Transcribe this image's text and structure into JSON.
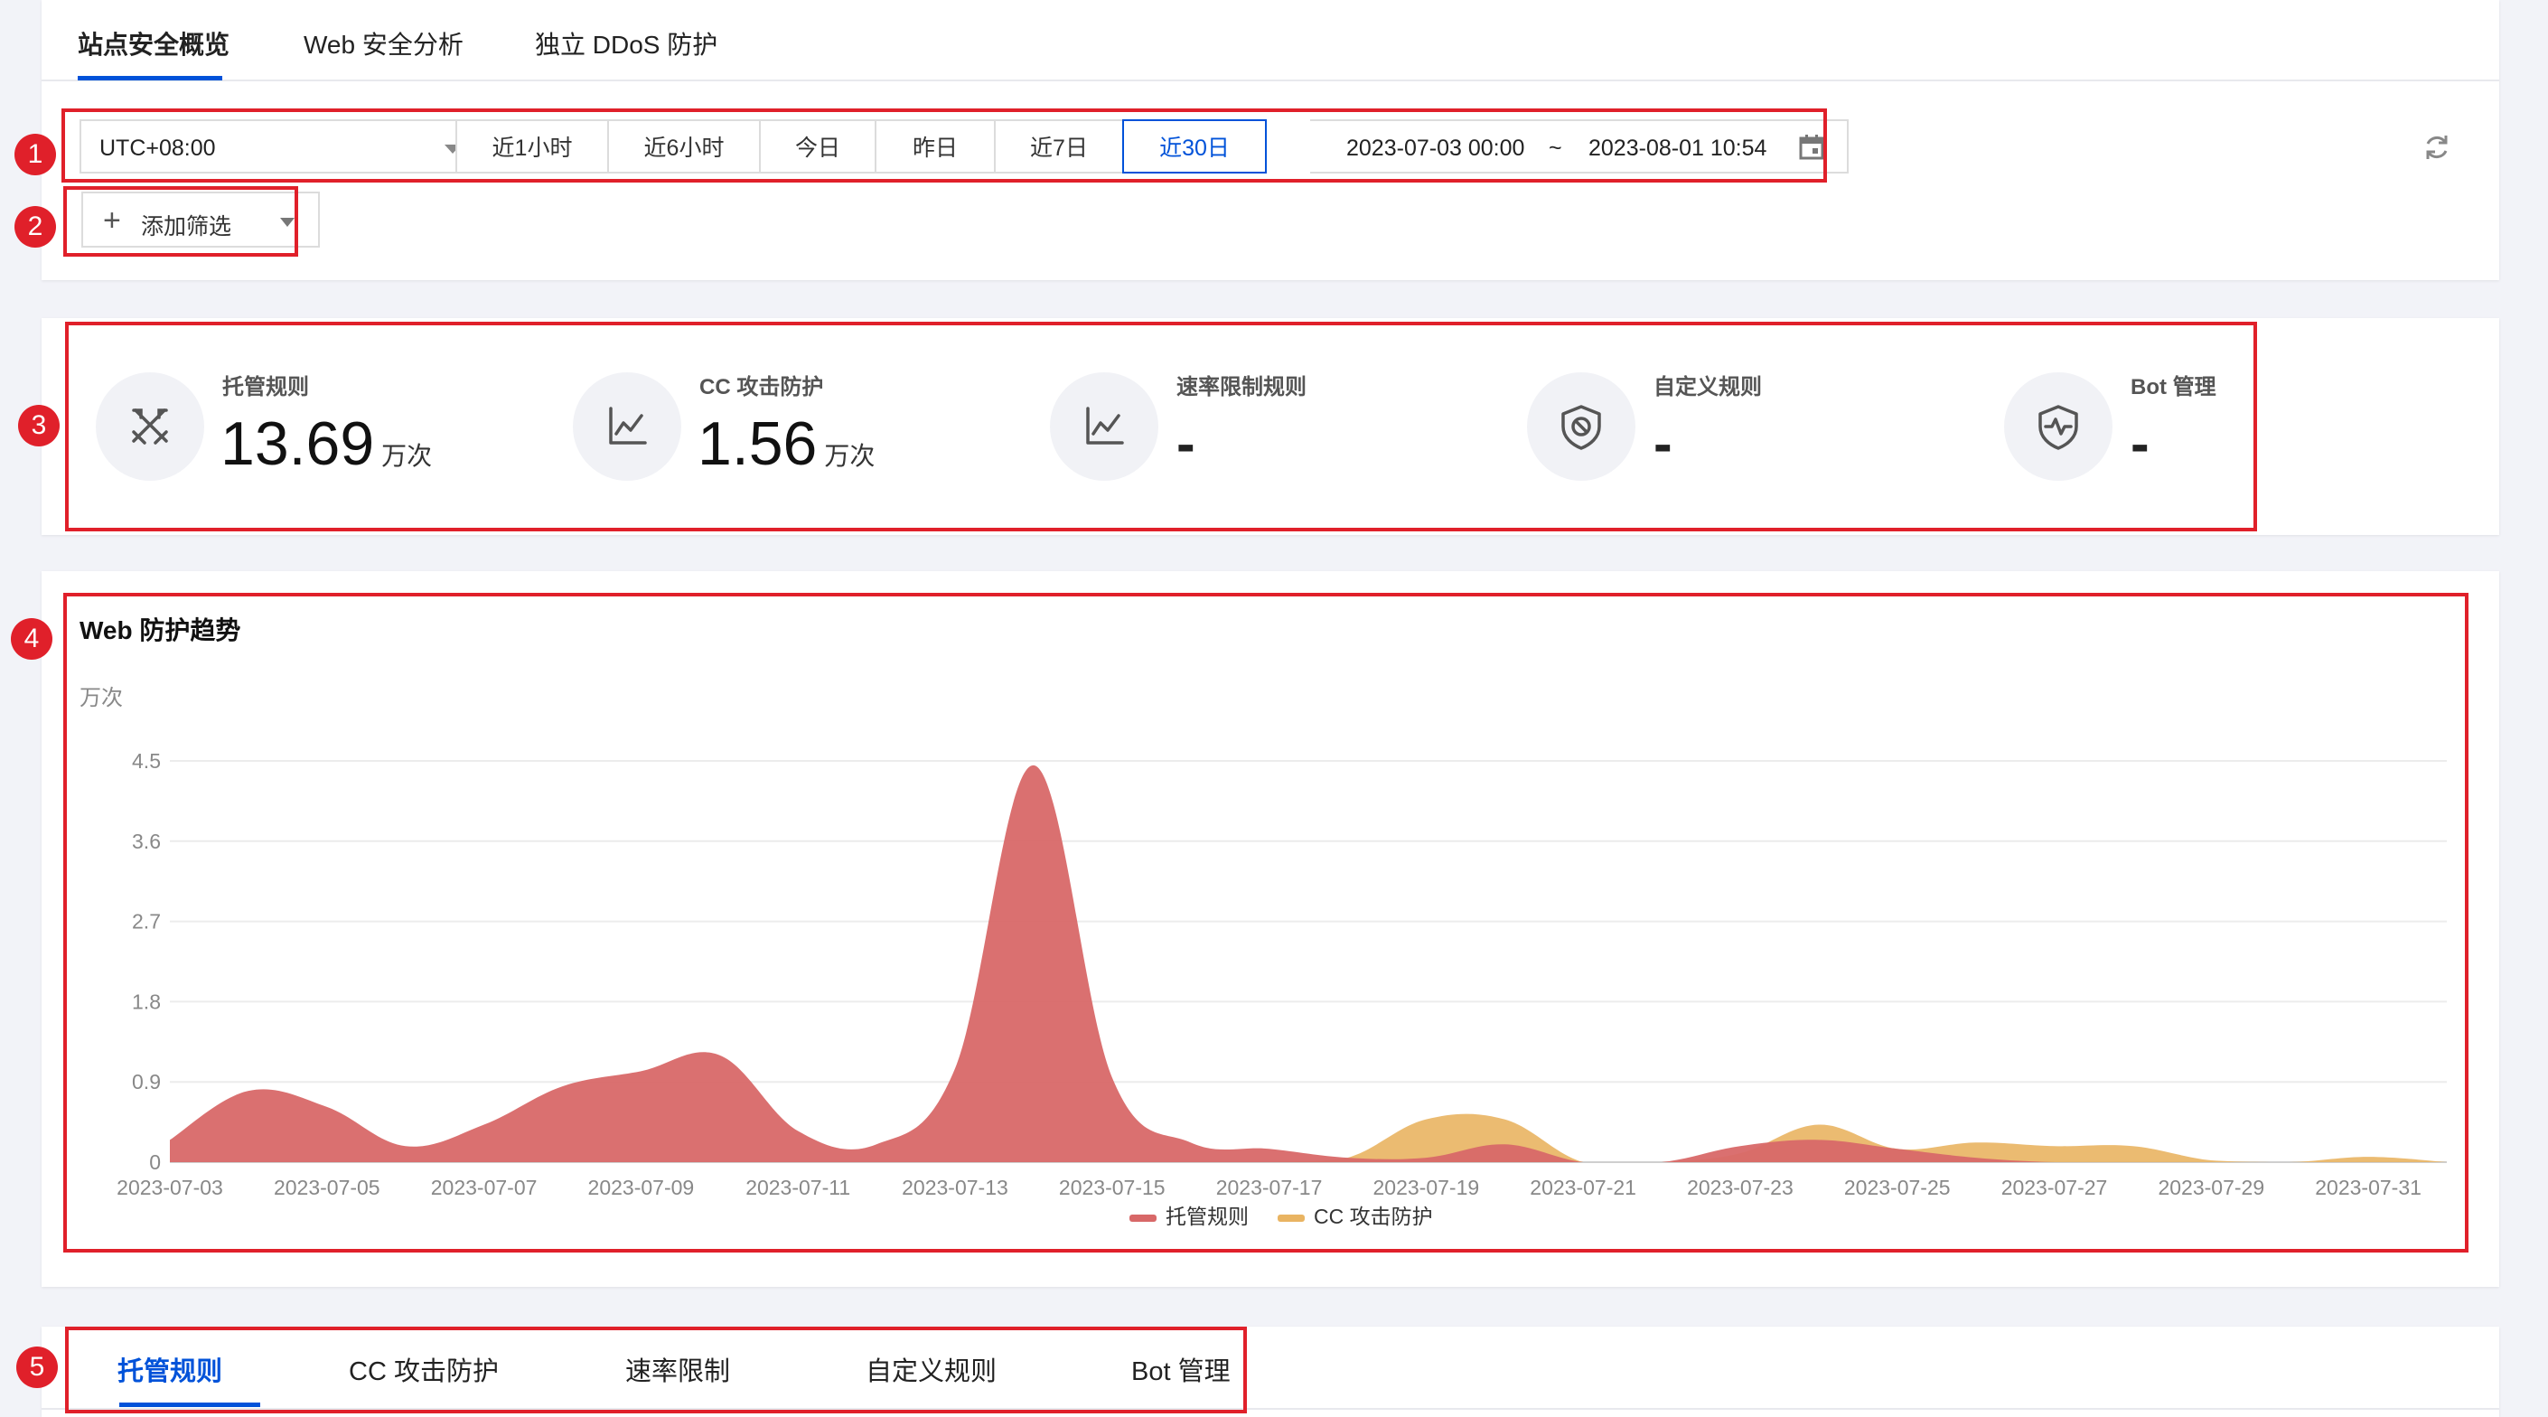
{
  "top_tabs": [
    {
      "label": "站点安全概览",
      "active": true
    },
    {
      "label": "Web 安全分析",
      "active": false
    },
    {
      "label": "独立 DDoS 防护",
      "active": false
    }
  ],
  "timezone": "UTC+08:00",
  "ranges": [
    {
      "label": "近1小时",
      "active": false
    },
    {
      "label": "近6小时",
      "active": false
    },
    {
      "label": "今日",
      "active": false
    },
    {
      "label": "昨日",
      "active": false
    },
    {
      "label": "近7日",
      "active": false
    },
    {
      "label": "近30日",
      "active": true
    }
  ],
  "date_range": {
    "start": "2023-07-03 00:00",
    "separator": "~",
    "end": "2023-08-01 10:54"
  },
  "filter": {
    "add_label": "添加筛选"
  },
  "stats": [
    {
      "label": "托管规则",
      "value": "13.69",
      "unit": "万次",
      "icon": "crossed-swords-icon"
    },
    {
      "label": "CC 攻击防护",
      "value": "1.56",
      "unit": "万次",
      "icon": "line-chart-icon"
    },
    {
      "label": "速率限制规则",
      "value": "-",
      "unit": "",
      "icon": "line-chart-icon"
    },
    {
      "label": "自定义规则",
      "value": "-",
      "unit": "",
      "icon": "shield-block-icon"
    },
    {
      "label": "Bot 管理",
      "value": "-",
      "unit": "",
      "icon": "shield-pulse-icon"
    }
  ],
  "chart": {
    "title": "Web 防护趋势",
    "unit": "万次"
  },
  "chart_data": {
    "type": "area",
    "title": "Web 防护趋势",
    "ylabel": "万次",
    "ylim": [
      0,
      4.5
    ],
    "yticks": [
      "0",
      "0.9",
      "1.8",
      "2.7",
      "3.6",
      "4.5"
    ],
    "grid": true,
    "legend": "bottom",
    "x": [
      "2023-07-03",
      "2023-07-04",
      "2023-07-05",
      "2023-07-06",
      "2023-07-07",
      "2023-07-08",
      "2023-07-09",
      "2023-07-10",
      "2023-07-11",
      "2023-07-12",
      "2023-07-13",
      "2023-07-14",
      "2023-07-15",
      "2023-07-16",
      "2023-07-17",
      "2023-07-18",
      "2023-07-19",
      "2023-07-20",
      "2023-07-21",
      "2023-07-22",
      "2023-07-23",
      "2023-07-24",
      "2023-07-25",
      "2023-07-26",
      "2023-07-27",
      "2023-07-28",
      "2023-07-29",
      "2023-07-30",
      "2023-07-31",
      "2023-08-01"
    ],
    "xticks": [
      "2023-07-03",
      "2023-07-05",
      "2023-07-07",
      "2023-07-09",
      "2023-07-11",
      "2023-07-13",
      "2023-07-15",
      "2023-07-17",
      "2023-07-19",
      "2023-07-21",
      "2023-07-23",
      "2023-07-25",
      "2023-07-27",
      "2023-07-29",
      "2023-07-31"
    ],
    "series": [
      {
        "name": "托管规则",
        "color": "#d86868",
        "values": [
          0.25,
          0.8,
          0.62,
          0.18,
          0.42,
          0.85,
          1.02,
          1.2,
          0.35,
          0.2,
          1.05,
          4.45,
          0.95,
          0.22,
          0.15,
          0.05,
          0.05,
          0.2,
          0.0,
          0.0,
          0.18,
          0.25,
          0.15,
          0.05,
          0.0,
          0.0,
          0.0,
          0.0,
          0.0,
          0.0
        ]
      },
      {
        "name": "CC 攻击防护",
        "color": "#e9b462",
        "values": [
          0.0,
          0.0,
          0.0,
          0.0,
          0.0,
          0.0,
          0.0,
          0.0,
          0.0,
          0.0,
          0.0,
          0.0,
          0.0,
          0.0,
          0.0,
          0.05,
          0.48,
          0.48,
          0.0,
          0.0,
          0.1,
          0.42,
          0.15,
          0.22,
          0.18,
          0.18,
          0.02,
          0.0,
          0.06,
          0.0
        ]
      }
    ]
  },
  "bottom_tabs": [
    {
      "label": "托管规则",
      "active": true
    },
    {
      "label": "CC 攻击防护",
      "active": false
    },
    {
      "label": "速率限制",
      "active": false
    },
    {
      "label": "自定义规则",
      "active": false
    },
    {
      "label": "Bot 管理",
      "active": false
    }
  ],
  "annotations": [
    "1",
    "2",
    "3",
    "4",
    "5"
  ]
}
